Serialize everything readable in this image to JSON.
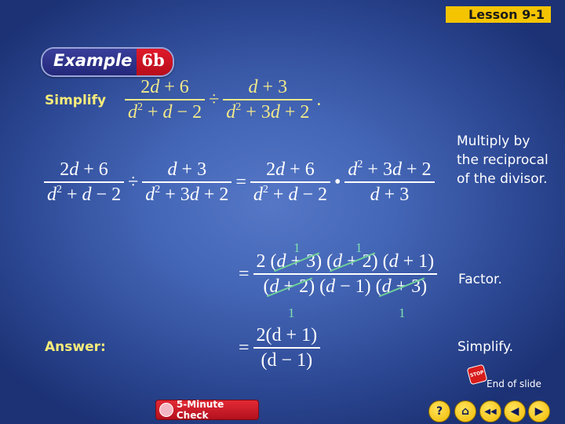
{
  "header": {
    "lesson": "Lesson 9-1"
  },
  "example": {
    "label": "Example",
    "number": "6b"
  },
  "problem": {
    "prompt": "Simplify",
    "num1": "2d + 6",
    "den1": "d² + d − 2",
    "op": "÷",
    "num2": "d + 3",
    "den2": "d² + 3d + 2",
    "end": "."
  },
  "steps": [
    {
      "note": "Multiply by the reciprocal of the divisor."
    },
    {
      "note": "Factor."
    },
    {
      "note": "Simplify."
    }
  ],
  "answer": {
    "label": "Answer:",
    "num": "2(d + 1)",
    "den": "(d − 1)"
  },
  "cancel_marks": [
    "1",
    "1",
    "1",
    "1"
  ],
  "footer": {
    "end_of_slide": "End of slide",
    "stop_icon_text": "STOP",
    "five_minute_check": "5-Minute Check",
    "nav": [
      {
        "name": "help",
        "glyph": "?"
      },
      {
        "name": "home",
        "glyph": "⌂"
      },
      {
        "name": "first",
        "glyph": "◀◀"
      },
      {
        "name": "previous",
        "glyph": "◀"
      },
      {
        "name": "next",
        "glyph": "▶"
      }
    ]
  },
  "colors": {
    "lesson_badge": "#f5c400",
    "label_yellow": "#f7ec7a",
    "cancel_line": "#6fd09a",
    "example_red": "#e01a2a"
  }
}
